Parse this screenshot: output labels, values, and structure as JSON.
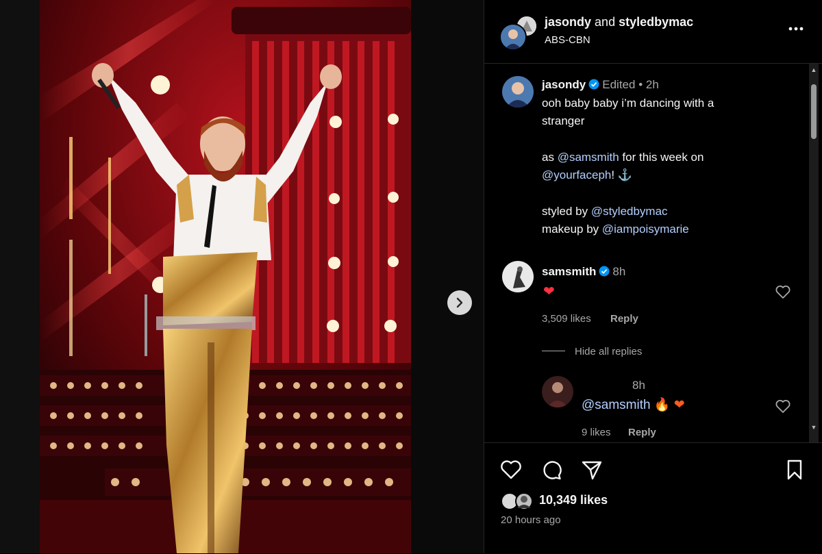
{
  "header": {
    "user1": "jasondy",
    "joiner": "and",
    "user2": "styledbymac",
    "subtitle": "ABS-CBN"
  },
  "caption": {
    "username": "jasondy",
    "edited": "Edited",
    "separator": "•",
    "time": "2h",
    "line1": "ooh baby baby i’m dancing with a",
    "line2": "stranger",
    "line3_pre": "as ",
    "line3_mention": "@samsmith",
    "line3_post": " for this week on",
    "line4_mention": "@yourfaceph",
    "line4_post": "! ⚓",
    "line5_pre": "styled by ",
    "line5_mention": "@styledbymac",
    "line6_pre": "makeup by ",
    "line6_mention": "@iampoisymarie"
  },
  "comment1": {
    "username": "samsmith",
    "time": "8h",
    "text": "❤",
    "likes": "3,509 likes",
    "reply": "Reply",
    "hide_replies": "Hide all replies"
  },
  "reply1": {
    "time": "8h",
    "mention": "@samsmith",
    "emoji": "🔥 ❤",
    "likes": "9 likes",
    "reply": "Reply"
  },
  "footer": {
    "likes": "10,349 likes",
    "time_ago": "20 hours ago"
  },
  "colors": {
    "verified": "#0095f6",
    "heart_red": "#ff3040",
    "panel_bg": "#000000",
    "border": "#262626"
  },
  "icons": {
    "more": "more-options-icon",
    "next": "chevron-right-icon",
    "like": "heart-icon",
    "comment": "comment-icon",
    "share": "share-icon",
    "save": "bookmark-icon"
  }
}
